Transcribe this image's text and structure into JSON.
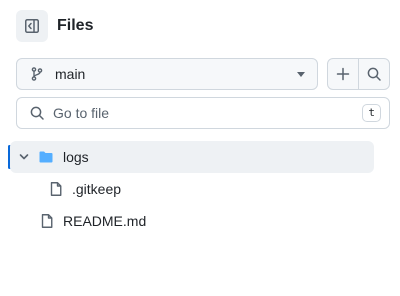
{
  "header": {
    "title": "Files",
    "sidebar_toggle_icon": "sidebar-collapse-icon"
  },
  "branch": {
    "name": "main",
    "icon": "git-branch-icon"
  },
  "actions": {
    "add_icon": "plus-icon",
    "search_icon": "search-icon"
  },
  "search": {
    "placeholder": "Go to file",
    "shortcut": "t"
  },
  "tree": [
    {
      "name": "logs",
      "type": "folder",
      "expanded": true,
      "depth": 0,
      "active": true
    },
    {
      "name": ".gitkeep",
      "type": "file",
      "depth": 1
    },
    {
      "name": "README.md",
      "type": "file",
      "depth": 0
    }
  ],
  "colors": {
    "accent": "#0969da",
    "folder": "#54aeff",
    "active_bg": "#eef1f4",
    "border": "#d0d7de"
  }
}
